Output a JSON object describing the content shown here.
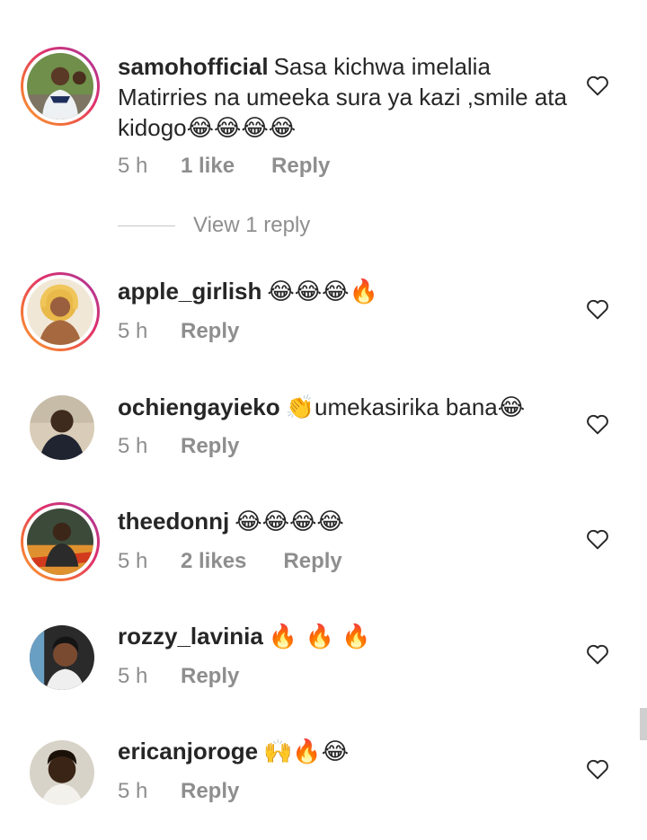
{
  "comments": [
    {
      "username": "samohofficial",
      "text": "Sasa kichwa imelalia Matirries na umeeka sura ya kazi ,smile ata kidogo😂😂😂😂",
      "time": "5 h",
      "likes": "1 like",
      "reply": "Reply",
      "story_ring": true,
      "avatar_icon": "user-avatar-icon"
    },
    {
      "username": "apple_girlish",
      "text": "😂😂😂🔥",
      "time": "5 h",
      "likes": "",
      "reply": "Reply",
      "story_ring": true,
      "avatar_icon": "user-avatar-icon"
    },
    {
      "username": "ochiengayieko",
      "text": "👏umekasirika bana😂",
      "time": "5 h",
      "likes": "",
      "reply": "Reply",
      "story_ring": false,
      "avatar_icon": "user-avatar-icon"
    },
    {
      "username": "theedonnj",
      "text": "😂😂😂😂",
      "time": "5 h",
      "likes": "2 likes",
      "reply": "Reply",
      "story_ring": true,
      "avatar_icon": "user-avatar-icon"
    },
    {
      "username": "rozzy_lavinia",
      "text": "🔥 🔥 🔥",
      "time": "5 h",
      "likes": "",
      "reply": "Reply",
      "story_ring": false,
      "avatar_icon": "user-avatar-icon"
    },
    {
      "username": "ericanjoroge",
      "text": "🙌🔥😂",
      "time": "5 h",
      "likes": "",
      "reply": "Reply",
      "story_ring": false,
      "avatar_icon": "user-avatar-icon"
    }
  ],
  "view_replies": "View 1 reply",
  "colors": {
    "text": "#262626",
    "secondary": "#8e8e8e",
    "story_ring_start": "#f9a13a",
    "story_ring_end": "#a334a6"
  }
}
